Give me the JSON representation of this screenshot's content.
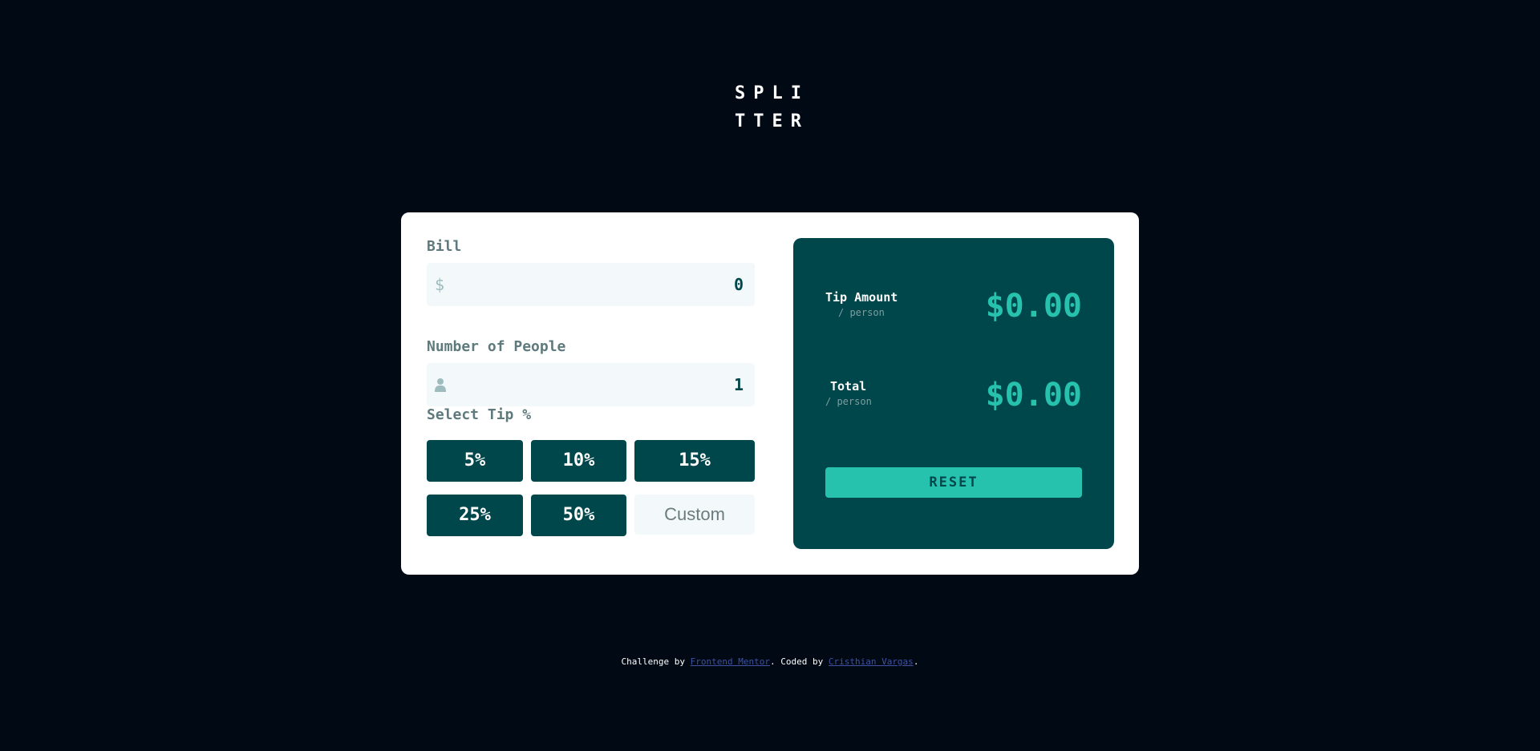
{
  "logo": {
    "line1": "SPLI",
    "line2": "TTER"
  },
  "bill": {
    "label": "Bill",
    "currency_symbol": "$",
    "value": "0"
  },
  "people": {
    "label": "Number of People",
    "icon": "person-icon",
    "value": "1"
  },
  "tip": {
    "label": "Select Tip %",
    "options": [
      "5%",
      "10%",
      "15%",
      "25%",
      "50%"
    ],
    "custom_placeholder": "Custom"
  },
  "results": {
    "tip_amount": {
      "label": "Tip Amount",
      "sub": "/ person",
      "value": "$0.00"
    },
    "total": {
      "label": "Total",
      "sub": "/ person",
      "value": "$0.00"
    },
    "reset_label": "RESET"
  },
  "footer": {
    "prefix": "Challenge by ",
    "link1": "Frontend Mentor",
    "middle": ". Coded by ",
    "link2": "Cristhian Vargas",
    "suffix": "."
  },
  "colors": {
    "page_bg": "#000914",
    "dark_teal": "#00474b",
    "accent": "#26c2ae",
    "input_bg": "#f3f9fa",
    "label_gray": "#5e7a7d"
  }
}
